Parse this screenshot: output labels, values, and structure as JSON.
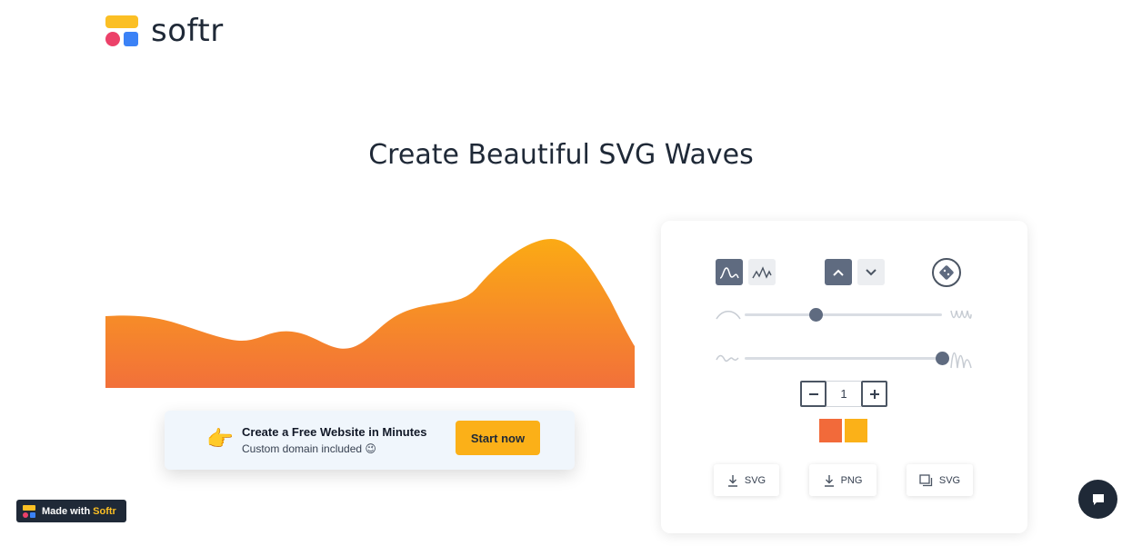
{
  "brand": {
    "name": "softr"
  },
  "headline": "Create Beautiful SVG Waves",
  "wave": {
    "gradient_top": "#fbaa14",
    "gradient_bottom": "#f2703a"
  },
  "promo": {
    "emoji": "👉",
    "title": "Create a Free Website in Minutes",
    "subtitle": "Custom domain included 😉",
    "button_label": "Start now"
  },
  "badge": {
    "prefix": "Made with",
    "brand": "Softr"
  },
  "controls": {
    "wave_type_icons": [
      "smooth-wave-icon",
      "peak-wave-icon"
    ],
    "direction_icons": [
      "chevron-up-icon",
      "chevron-down-icon"
    ],
    "randomize_icon": "dice-icon",
    "complexity_slider": {
      "value": 0.36
    },
    "contrast_slider": {
      "value": 1.0
    },
    "layers": {
      "value": "1"
    },
    "colors": [
      "#f26a3a",
      "#fbb118"
    ],
    "downloads": [
      {
        "label": "SVG",
        "icon": "download-icon"
      },
      {
        "label": "PNG",
        "icon": "download-icon"
      },
      {
        "label": "SVG",
        "icon": "copy-icon"
      }
    ]
  },
  "chat": {
    "icon": "chat-bubble-icon"
  }
}
